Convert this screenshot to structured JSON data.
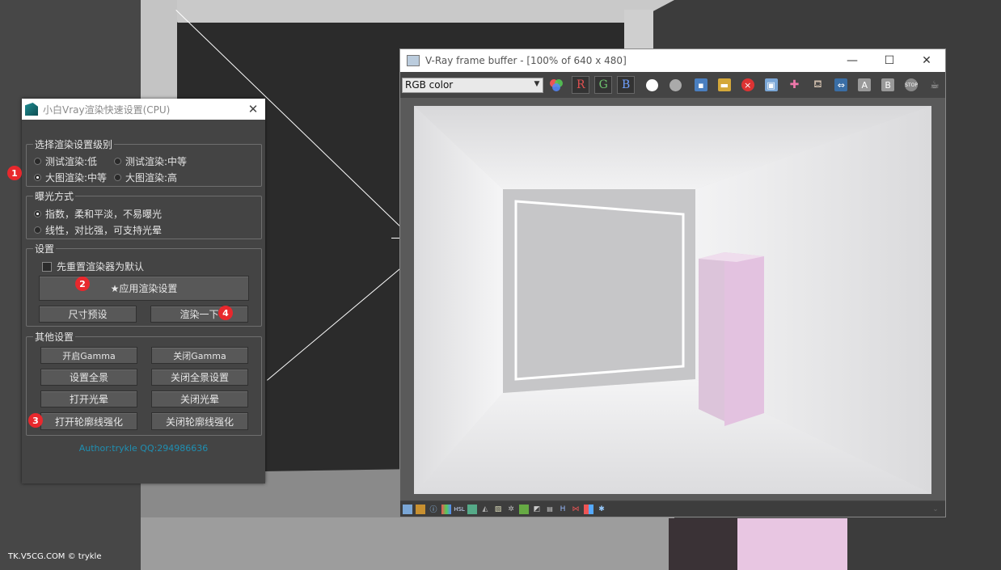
{
  "dialog": {
    "title": "小白Vray渲染快速设置(CPU)",
    "close_icon": "close-icon",
    "group1": {
      "label": "选择渲染设置级别",
      "options": [
        {
          "label": "测试渲染:低",
          "selected": false
        },
        {
          "label": "测试渲染:中等",
          "selected": false
        },
        {
          "label": "大图渲染:中等",
          "selected": true
        },
        {
          "label": "大图渲染:高",
          "selected": false
        }
      ]
    },
    "group2": {
      "label": "曝光方式",
      "options": [
        {
          "label": "指数，柔和平淡，不易曝光",
          "selected": true
        },
        {
          "label": "线性，对比强，可支持光晕",
          "selected": false
        }
      ]
    },
    "group3": {
      "label": "设置",
      "checkbox_label": "先重置渲染器为默认",
      "apply_label": "★应用渲染设置",
      "size_preset_label": "尺寸预设",
      "render_label": "渲染一下"
    },
    "group4": {
      "label": "其他设置",
      "buttons": [
        "开启Gamma",
        "关闭Gamma",
        "设置全景",
        "关闭全景设置",
        "打开光晕",
        "关闭光晕",
        "打开轮廓线强化",
        "关闭轮廓线强化"
      ]
    },
    "author": "Author:trykle QQ:294986636",
    "badges": [
      "1",
      "2",
      "3",
      "4"
    ]
  },
  "vfb": {
    "title": "V-Ray frame buffer - [100% of 640 x 480]",
    "channel_select": "RGB color",
    "channels": [
      "R",
      "G",
      "B"
    ],
    "window_controls": [
      "minimize-icon",
      "maximize-icon",
      "close-icon"
    ],
    "status_h": "H"
  },
  "watermark": "TK.V5CG.COM © trykle",
  "colors": {
    "dialog_bg": "#444444",
    "author": "#1f8fb2",
    "badge": "#e8282d",
    "pink_box": "#e8c6e2",
    "channel_r": "#e05050",
    "channel_g": "#6fc46f",
    "channel_b": "#6fa0ff"
  }
}
